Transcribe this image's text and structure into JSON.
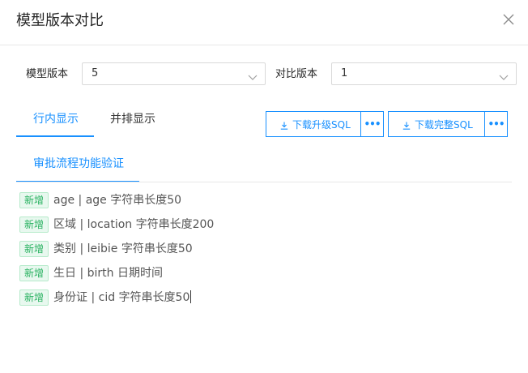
{
  "dialog": {
    "title": "模型版本对比",
    "close_icon": "close-icon"
  },
  "filters": {
    "model_version_label": "模型版本",
    "model_version_value": "5",
    "compare_version_label": "对比版本",
    "compare_version_value": "1"
  },
  "tabs": [
    {
      "label": "行内显示",
      "active": true
    },
    {
      "label": "并排显示",
      "active": false
    }
  ],
  "actions": {
    "download_upgrade_sql": "下载升级SQL",
    "download_full_sql": "下载完整SQL",
    "more_symbol": "•••"
  },
  "subtabs": [
    {
      "label": "审批流程功能验证",
      "active": true
    }
  ],
  "changes": [
    {
      "badge": "新增",
      "text": "age | age 字符串长度50"
    },
    {
      "badge": "新增",
      "text": "区域 | location 字符串长度200"
    },
    {
      "badge": "新增",
      "text": "类别 | leibie 字符串长度50"
    },
    {
      "badge": "新增",
      "text": "生日 | birth 日期时间"
    },
    {
      "badge": "新增",
      "text": "身份证 | cid 字符串长度50"
    }
  ],
  "colors": {
    "accent": "#1890ff",
    "added_badge_text": "#27b15f",
    "added_badge_bg": "#e8f8ef"
  }
}
